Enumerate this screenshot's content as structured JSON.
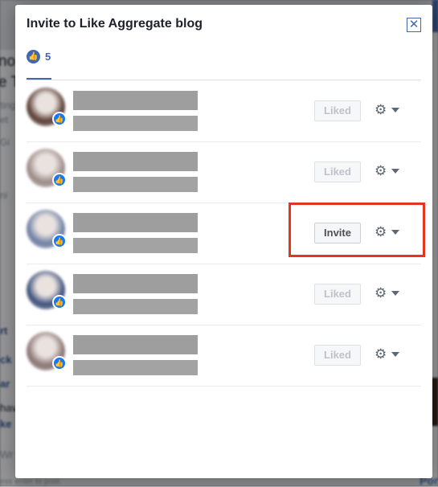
{
  "dialog": {
    "title": "Invite to Like Aggregate blog",
    "close_icon": "close-icon"
  },
  "tabs": [
    {
      "icon": "like-thumb-icon",
      "count": "5"
    }
  ],
  "people": [
    {
      "button": "Liked",
      "state": "liked",
      "avatar_color": "#5a3c32"
    },
    {
      "button": "Liked",
      "state": "liked",
      "avatar_color": "#9c8a86"
    },
    {
      "button": "Invite",
      "state": "invite",
      "avatar_color": "#6d7fa4"
    },
    {
      "button": "Liked",
      "state": "liked",
      "avatar_color": "#3c507a"
    },
    {
      "button": "Liked",
      "state": "liked",
      "avatar_color": "#8a7470"
    }
  ],
  "annotation": {
    "color": "#e63422"
  },
  "background": {
    "fragments": [
      "no",
      "e T",
      "ting",
      "et",
      "Gi",
      "ni",
      "rt",
      "ck",
      "ar",
      "hav",
      "ke",
      "Wr",
      "ess enter to post.",
      "Por"
    ]
  }
}
